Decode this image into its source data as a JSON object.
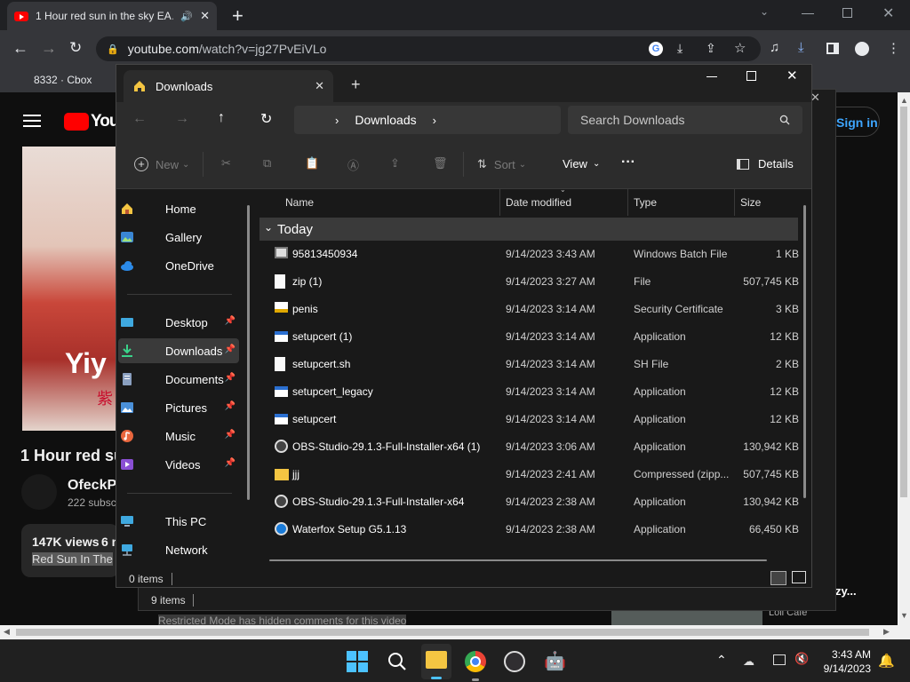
{
  "browser": {
    "tab_title": "1 Hour red sun in the sky EA…",
    "new_tab": "+",
    "url_host": "youtube.com",
    "url_path": "/watch?v=jg27PvEiVLo",
    "bookmark_1": "8332 · Cbox"
  },
  "youtube": {
    "logo_text": "You",
    "sign_in": "Sign in",
    "thumb_text": "Yiy",
    "video_title": "1 Hour red su",
    "channel_name": "OfeckPe",
    "subscribers": "222 subsc",
    "views": "147K views",
    "age": "6 n",
    "desc": "Red Sun In The",
    "restricted": "Restricted Mode has hidden comments for this video",
    "side_item": "Loli Cafe",
    "side_title_dots": "zy..."
  },
  "explorer": {
    "tab_title": "Downloads",
    "address": "Downloads",
    "search_placeholder": "Search Downloads",
    "cmd": {
      "new": "New",
      "sort": "Sort",
      "view": "View",
      "more": "···",
      "details": "Details"
    },
    "nav": [
      {
        "label": "Home"
      },
      {
        "label": "Gallery"
      },
      {
        "label": "OneDrive"
      },
      {
        "label": "Desktop"
      },
      {
        "label": "Downloads"
      },
      {
        "label": "Documents"
      },
      {
        "label": "Pictures"
      },
      {
        "label": "Music"
      },
      {
        "label": "Videos"
      },
      {
        "label": "This PC"
      },
      {
        "label": "Network"
      }
    ],
    "columns": {
      "name": "Name",
      "date": "Date modified",
      "type": "Type",
      "size": "Size"
    },
    "group_label": "Today",
    "files": [
      {
        "name": "95813450934",
        "date": "9/14/2023 3:43 AM",
        "type": "Windows Batch File",
        "size": "1 KB",
        "icon": "batch-file-icon"
      },
      {
        "name": "zip (1)",
        "date": "9/14/2023 3:27 AM",
        "type": "File",
        "size": "507,745 KB",
        "icon": "file-icon"
      },
      {
        "name": "penis",
        "date": "9/14/2023 3:14 AM",
        "type": "Security Certificate",
        "size": "3 KB",
        "icon": "certificate-icon"
      },
      {
        "name": "setupcert (1)",
        "date": "9/14/2023 3:14 AM",
        "type": "Application",
        "size": "12 KB",
        "icon": "application-icon"
      },
      {
        "name": "setupcert.sh",
        "date": "9/14/2023 3:14 AM",
        "type": "SH File",
        "size": "2 KB",
        "icon": "file-icon"
      },
      {
        "name": "setupcert_legacy",
        "date": "9/14/2023 3:14 AM",
        "type": "Application",
        "size": "12 KB",
        "icon": "application-icon"
      },
      {
        "name": "setupcert",
        "date": "9/14/2023 3:14 AM",
        "type": "Application",
        "size": "12 KB",
        "icon": "application-icon"
      },
      {
        "name": "OBS-Studio-29.1.3-Full-Installer-x64 (1)",
        "date": "9/14/2023 3:06 AM",
        "type": "Application",
        "size": "130,942 KB",
        "icon": "obs-icon"
      },
      {
        "name": "jjj",
        "date": "9/14/2023 2:41 AM",
        "type": "Compressed (zipp...",
        "size": "507,745 KB",
        "icon": "zip-folder-icon"
      },
      {
        "name": "OBS-Studio-29.1.3-Full-Installer-x64",
        "date": "9/14/2023 2:38 AM",
        "type": "Application",
        "size": "130,942 KB",
        "icon": "obs-icon"
      },
      {
        "name": "Waterfox Setup G5.1.13",
        "date": "9/14/2023 2:38 AM",
        "type": "Application",
        "size": "66,450 KB",
        "icon": "waterfox-icon"
      }
    ],
    "status_items": "0 items",
    "back_status_items": "9 items"
  },
  "taskbar": {
    "time": "3:43 AM",
    "date": "9/14/2023"
  },
  "colors": {
    "youtube_red": "#ff0000",
    "folder_yellow": "#f4c542",
    "accent_blue": "#3ea6ff"
  }
}
